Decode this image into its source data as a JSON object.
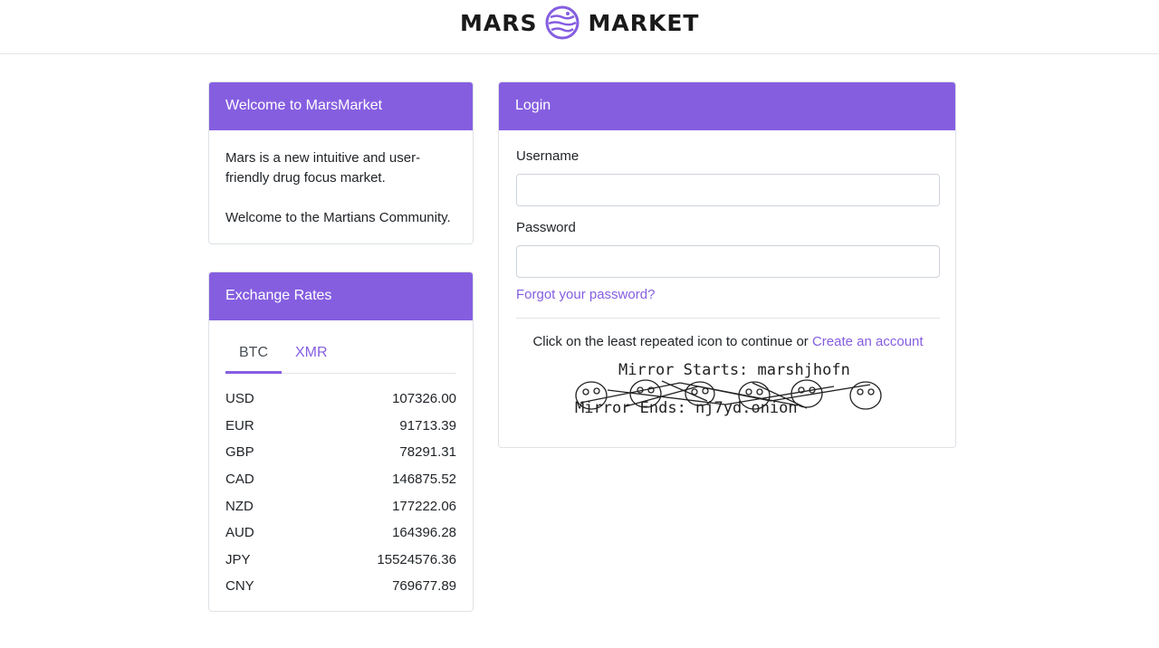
{
  "brand": {
    "left": "MARS",
    "right": "MARKET",
    "accent": "#855ee0"
  },
  "welcome": {
    "title": "Welcome to MarsMarket",
    "line1": "Mars is a new intuitive and user-friendly drug focus market.",
    "line2": "Welcome to the Martians Community."
  },
  "rates": {
    "title": "Exchange Rates",
    "tabs": [
      "BTC",
      "XMR"
    ],
    "active_tab": "BTC",
    "rows": [
      {
        "currency": "USD",
        "value": "107326.00"
      },
      {
        "currency": "EUR",
        "value": "91713.39"
      },
      {
        "currency": "GBP",
        "value": "78291.31"
      },
      {
        "currency": "CAD",
        "value": "146875.52"
      },
      {
        "currency": "NZD",
        "value": "177222.06"
      },
      {
        "currency": "AUD",
        "value": "164396.28"
      },
      {
        "currency": "JPY",
        "value": "15524576.36"
      },
      {
        "currency": "CNY",
        "value": "769677.89"
      }
    ]
  },
  "login": {
    "title": "Login",
    "username_label": "Username",
    "username_value": "",
    "password_label": "Password",
    "password_value": "",
    "forgot": "Forgot your password?",
    "captcha_prompt": "Click on the least repeated icon to continue or",
    "create_account": "Create an account",
    "mirror_start": "Mirror Starts: marshjhofn",
    "mirror_end": "Mirror Ends: nj7yd.onion"
  }
}
